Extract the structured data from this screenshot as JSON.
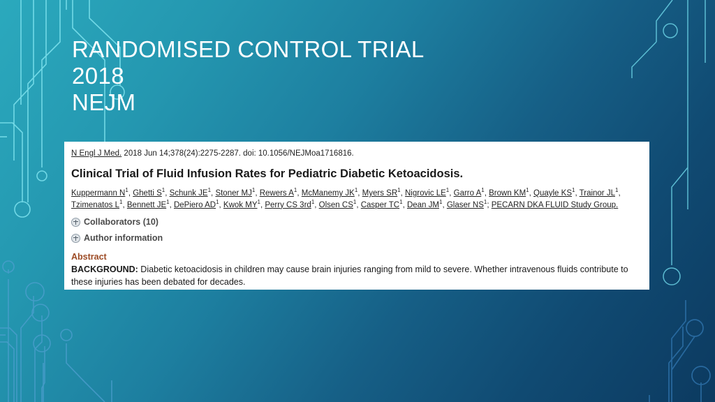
{
  "slide": {
    "title_lines": [
      "RANDOMISED CONTROL TRIAL",
      "2018",
      "NEJM"
    ],
    "background_accent": "#2ba9bd",
    "background_deep": "#0c3a60",
    "trace_color": "#7fe3ef"
  },
  "article": {
    "journal": "N Engl J Med.",
    "citation_rest": " 2018 Jun 14;378(24):2275-2287. doi: 10.1056/NEJMoa1716816.",
    "title": "Clinical Trial of Fluid Infusion Rates for Pediatric Diabetic Ketoacidosis.",
    "authors": [
      "Kuppermann N",
      "Ghetti S",
      "Schunk JE",
      "Stoner MJ",
      "Rewers A",
      "McManemy JK",
      "Myers SR",
      "Nigrovic LE",
      "Garro A",
      "Brown KM",
      "Quayle KS",
      "Trainor JL",
      "Tzimenatos L",
      "Bennett JE",
      "DePiero AD",
      "Kwok MY",
      "Perry CS 3rd",
      "Olsen CS",
      "Casper TC",
      "Dean JM",
      "Glaser NS"
    ],
    "author_affiliation_marker": "1",
    "study_group": "PECARN DKA FLUID Study Group.",
    "collaborators_label": "Collaborators (10)",
    "author_information_label": "Author information",
    "abstract_heading": "Abstract",
    "abstract_label": "BACKGROUND:",
    "abstract_text": " Diabetic ketoacidosis in children may cause brain injuries ranging from mild to severe. Whether intravenous fluids contribute to these injuries has been debated for decades.",
    "abstract_heading_color": "#9c4a24"
  }
}
